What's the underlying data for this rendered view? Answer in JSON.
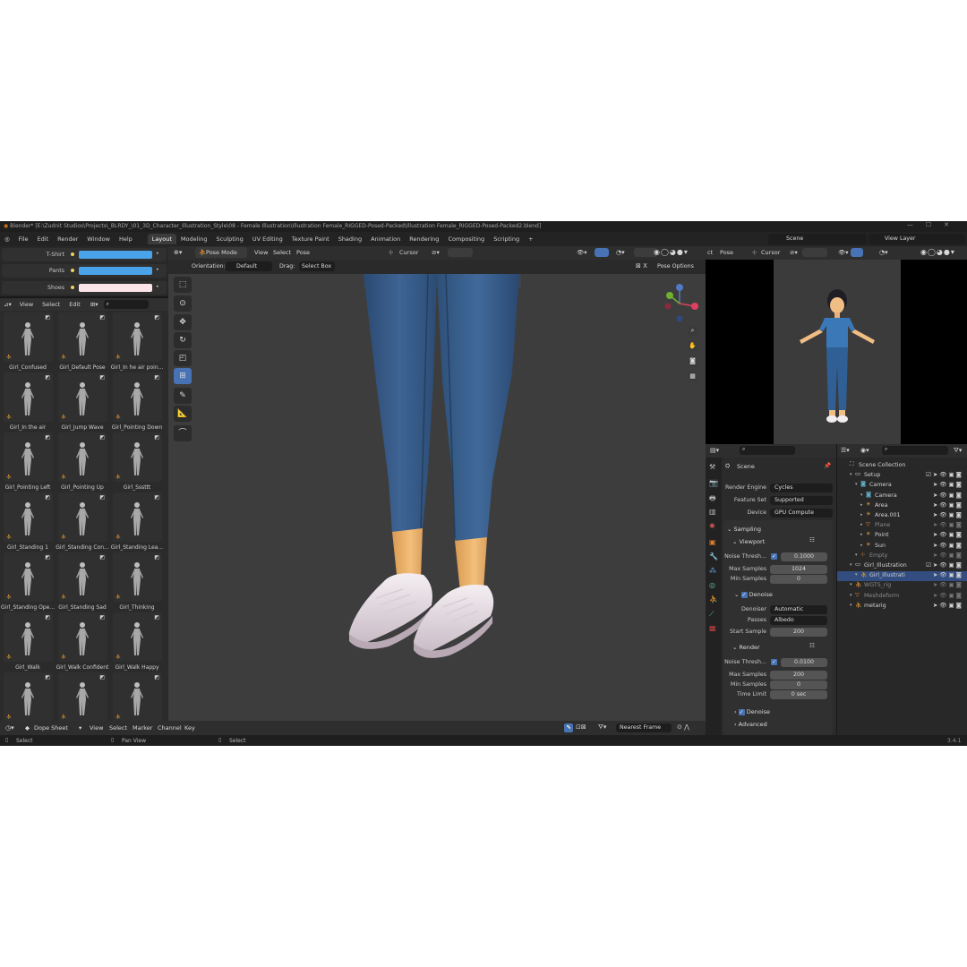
{
  "titlebar": {
    "title": "Blender* [E:\\Zudnit Studios\\Projects\\_BLRDY_\\01_3D_Character_Illustration_Style\\08 - Female Illustration\\Illustration Female_RIGGED-Posed-Packed\\Illustration Female_RIGGED-Posed-Packed2.blend]"
  },
  "menu": {
    "file": "File",
    "edit": "Edit",
    "render": "Render",
    "window": "Window",
    "help": "Help"
  },
  "workspaces": [
    "Layout",
    "Modeling",
    "Sculpting",
    "UV Editing",
    "Texture Paint",
    "Shading",
    "Animation",
    "Rendering",
    "Compositing",
    "Scripting"
  ],
  "scene": {
    "name": "Scene",
    "view_layer": "View Layer"
  },
  "colors_panel": {
    "items": [
      {
        "label": "T-Shirt",
        "color": "#4aa3e8"
      },
      {
        "label": "Pants",
        "color": "#4aa3e8"
      },
      {
        "label": "Shoes",
        "color": "#fbe5e8"
      }
    ]
  },
  "asset_browser": {
    "menu": {
      "view": "View",
      "select": "Select",
      "edit": "Edit"
    },
    "items": [
      "Girl_Confused",
      "Girl_Default Pose",
      "Girl_In he air poin...",
      "Girl_In the air",
      "Girl_Jump Wave",
      "Girl_Pointing Down",
      "Girl_Pointing Left",
      "Girl_Pointing Up",
      "Girl_Sssttt",
      "Girl_Standing 1",
      "Girl_Standing Con...",
      "Girl_Standing Lea...",
      "Girl_Standing Ope...",
      "Girl_Standing Sad",
      "Girl_Thinking",
      "Girl_Walk",
      "Girl_Walk Confident",
      "Girl_Walk Happy",
      "",
      "",
      ""
    ]
  },
  "viewport": {
    "mode": "Pose Mode",
    "menu": {
      "view": "View",
      "select": "Select",
      "pose": "Pose"
    },
    "orientation_label": "Orientation:",
    "orientation_value": "Default",
    "drag_label": "Drag:",
    "drag_value": "Select Box",
    "cursor": "Cursor",
    "pose_options": "Pose Options"
  },
  "camera_view": {
    "mode": "ct",
    "pose": "Pose",
    "cursor": "Cursor"
  },
  "properties": {
    "scene_label": "Scene",
    "render_engine_label": "Render Engine",
    "render_engine": "Cycles",
    "feature_set_label": "Feature Set",
    "feature_set": "Supported",
    "device_label": "Device",
    "device": "GPU Compute",
    "sampling": "Sampling",
    "viewport": "Viewport",
    "noise_thresh_label": "Noise Thresh...",
    "vp_noise": "0.1000",
    "max_samples_label": "Max Samples",
    "vp_max": "1024",
    "min_samples_label": "Min Samples",
    "vp_min": "0",
    "denoise": "Denoise",
    "denoiser_label": "Denoiser",
    "denoiser": "Automatic",
    "passes_label": "Passes",
    "passes": "Albedo",
    "start_sample_label": "Start Sample",
    "start_sample": "200",
    "render": "Render",
    "r_noise": "0.0100",
    "r_max": "200",
    "r_min": "0",
    "time_limit_label": "Time Limit",
    "time_limit": "0 sec",
    "denoise2": "Denoise",
    "advanced": "Advanced"
  },
  "outliner": {
    "items": [
      {
        "label": "Scene Collection",
        "indent": 0
      },
      {
        "label": "Setup",
        "indent": 1
      },
      {
        "label": "Camera",
        "indent": 2
      },
      {
        "label": "Camera",
        "indent": 3
      },
      {
        "label": "Area",
        "indent": 3
      },
      {
        "label": "Area.001",
        "indent": 3
      },
      {
        "label": "Plane",
        "indent": 3
      },
      {
        "label": "Point",
        "indent": 3
      },
      {
        "label": "Sun",
        "indent": 3
      },
      {
        "label": "Empty",
        "indent": 2
      },
      {
        "label": "Girl_Illustration",
        "indent": 1
      },
      {
        "label": "Girl_Illustrati",
        "indent": 2
      },
      {
        "label": "WGTS_rig",
        "indent": 1
      },
      {
        "label": "Meshdeform",
        "indent": 1
      },
      {
        "label": "metarig",
        "indent": 1
      }
    ]
  },
  "timeline": {
    "editor": "Dope Sheet",
    "menu": {
      "view": "View",
      "select": "Select",
      "marker": "Marker",
      "channel": "Channel",
      "key": "Key"
    },
    "snap": "Nearest Frame"
  },
  "statusbar": {
    "select": "Select",
    "pan_view": "Pan View",
    "select2": "Select",
    "version": "3.4.1"
  }
}
